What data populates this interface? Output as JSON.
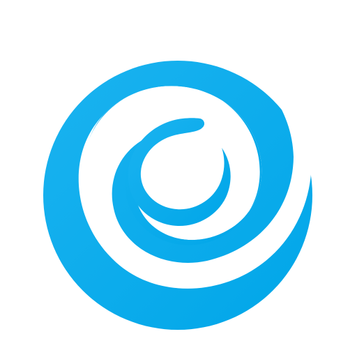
{
  "logo": {
    "icon": "blue-swirl-logo-icon",
    "colors": {
      "background": "#ffffff",
      "primary": "#0AACEB",
      "gradient_top_left": "#1BB3F0",
      "gradient_bottom_right": "#00A6E8",
      "negative_space": "#ffffff"
    }
  }
}
